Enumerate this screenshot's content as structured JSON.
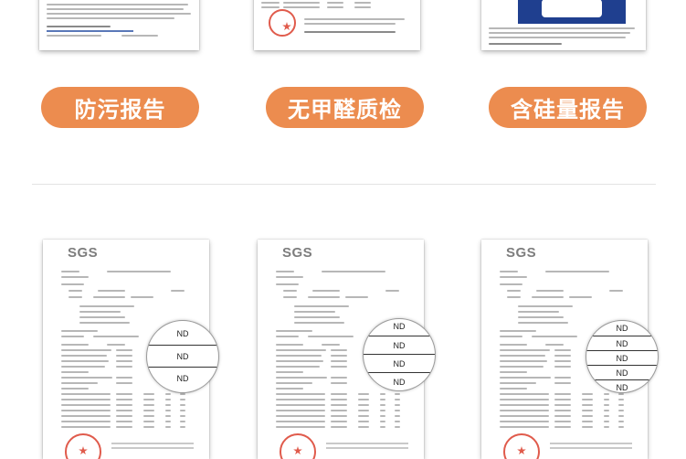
{
  "top_reports": [
    {
      "label": "防污报告"
    },
    {
      "label": "无甲醛质检"
    },
    {
      "label": "含硅量报告"
    }
  ],
  "sgs_reports": [
    {
      "logo": "SGS",
      "zoom_values": [
        "ND",
        "ND",
        "ND"
      ]
    },
    {
      "logo": "SGS",
      "zoom_values": [
        "ND",
        "ND",
        "ND",
        "ND"
      ]
    },
    {
      "logo": "SGS",
      "zoom_values": [
        "ND",
        "ND",
        "ND",
        "ND",
        "ND"
      ]
    }
  ],
  "colors": {
    "pill_background": "#ec8c4f",
    "pill_text": "#ffffff",
    "seal_red": "#e05b4c",
    "logo_gray": "#7d7d7d"
  }
}
